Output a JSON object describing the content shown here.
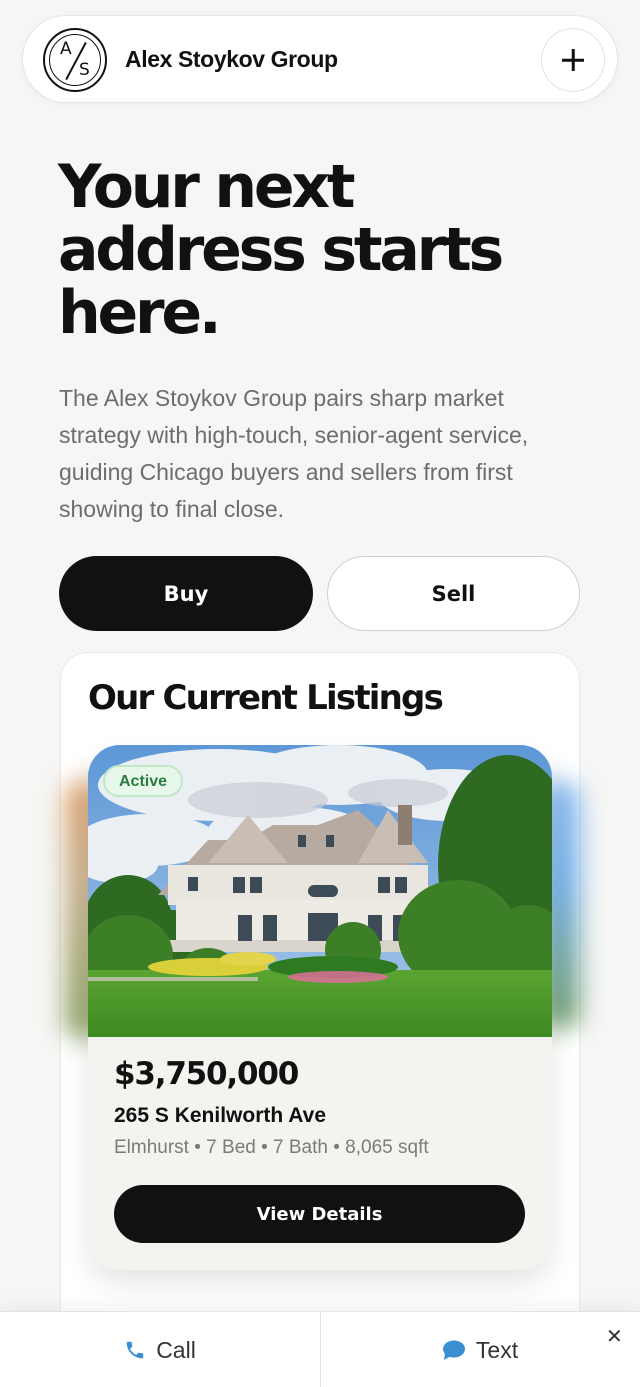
{
  "header": {
    "logo_letters": {
      "top": "A",
      "bottom": "S"
    },
    "brand_name": "Alex Stoykov Group",
    "menu_icon": "plus-icon"
  },
  "hero": {
    "headline": "Your next address starts here.",
    "intro": "The Alex Stoykov Group pairs sharp market strategy with high-touch, senior-agent service, guiding Chicago buyers and sellers from first showing to final close.",
    "buy_label": "Buy",
    "sell_label": "Sell"
  },
  "listings": {
    "title": "Our Current Listings",
    "items": [
      {
        "status": "Active",
        "price": "$3,750,000",
        "address": "265 S Kenilworth Ave",
        "details": "Elmhurst • 7 Bed • 7 Bath • 8,065 sqft",
        "cta": "View Details"
      }
    ]
  },
  "contact_bar": {
    "call_label": "Call",
    "text_label": "Text",
    "call_icon": "phone-icon",
    "text_icon": "chat-bubble-icon",
    "close_icon": "close-icon",
    "close_glyph": "✕"
  },
  "colors": {
    "page_bg": "#f6f6f5",
    "primary": "#111111",
    "badge_bg": "#e7f8ea",
    "badge_text": "#2b7a40",
    "icon_blue": "#3a8fd0"
  }
}
